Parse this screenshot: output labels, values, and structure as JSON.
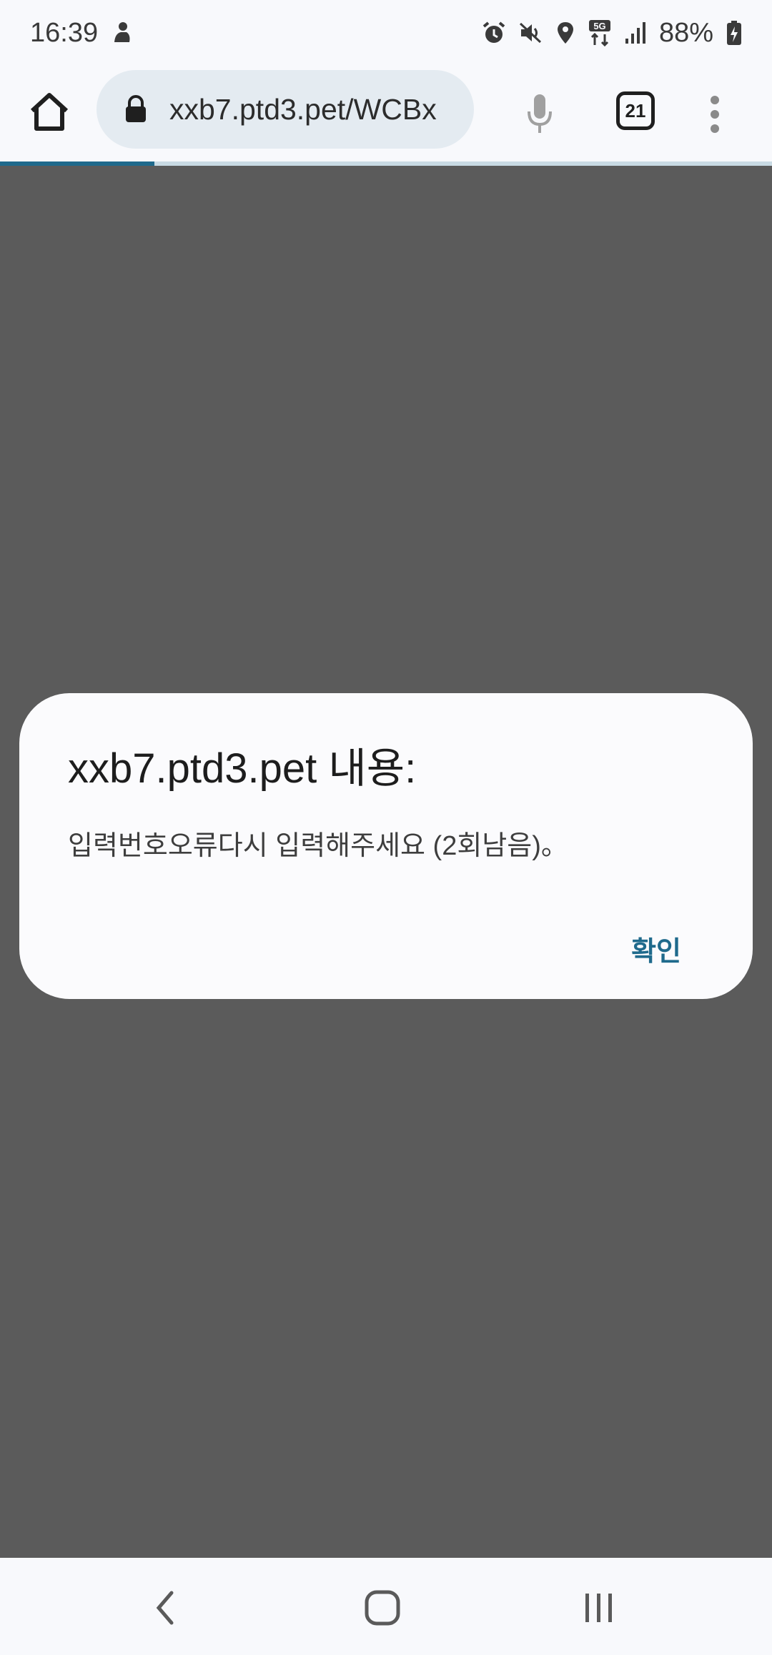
{
  "status_bar": {
    "time": "16:39",
    "battery": "88%",
    "network": "5G"
  },
  "toolbar": {
    "url": "xxb7.ptd3.pet/WCBx",
    "tab_count": "21",
    "load_progress": 0.2
  },
  "dialog": {
    "title": "xxb7.ptd3.pet 내용:",
    "message": "입력번호오류다시 입력해주세요 (2회남음)。",
    "ok_label": "확인"
  },
  "colors": {
    "accent": "#1f6a8c",
    "overlay": "#5b5b5b"
  }
}
